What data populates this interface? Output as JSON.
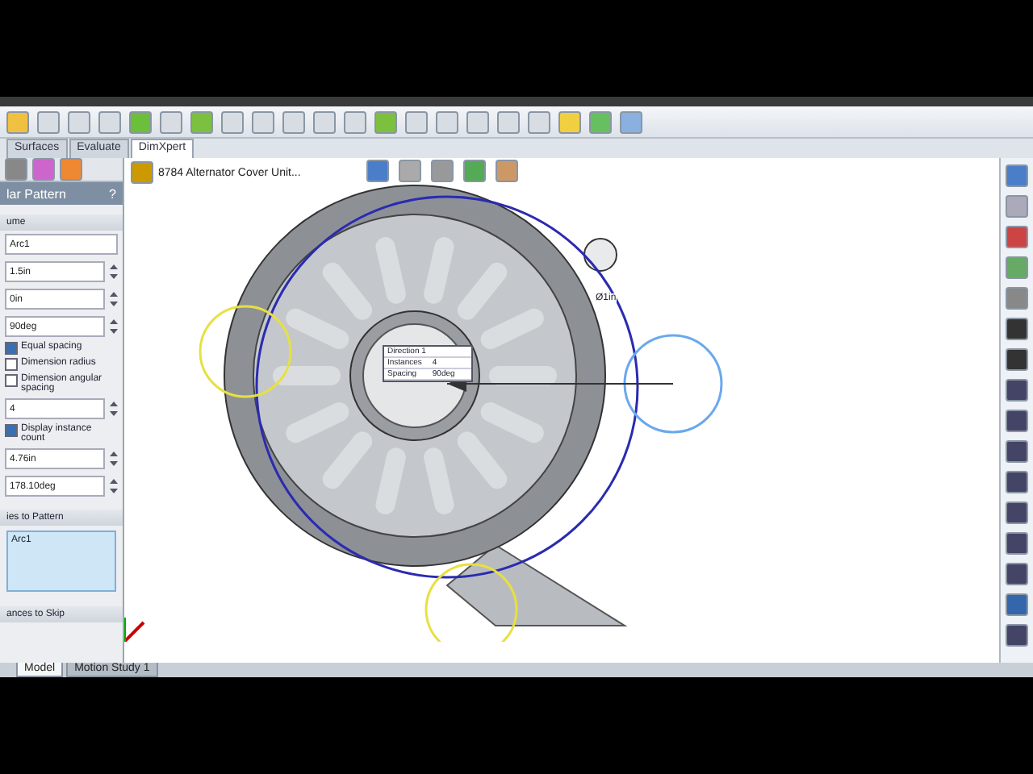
{
  "command_tabs": [
    {
      "label": "Surfaces",
      "selected": false
    },
    {
      "label": "Evaluate",
      "selected": false
    },
    {
      "label": "DimXpert",
      "selected": true
    }
  ],
  "feature_tree": {
    "label": "8784 Alternator Cover Unit..."
  },
  "property_manager": {
    "title": "lar Pattern",
    "help": "?",
    "parameters": {
      "title": "ume",
      "fields": [
        {
          "value": "Arc1"
        },
        {
          "value": "1.5in"
        },
        {
          "value": "0in"
        },
        {
          "value": "90deg"
        }
      ],
      "options": [
        {
          "label": "Equal spacing",
          "checked": true
        },
        {
          "label": "Dimension radius",
          "checked": false
        },
        {
          "label": "Dimension angular spacing",
          "checked": false
        }
      ],
      "count": {
        "value": "4"
      },
      "display_count": {
        "label": "Display instance count",
        "checked": true
      },
      "extra_fields": [
        {
          "value": "4.76in"
        },
        {
          "value": "178.10deg"
        }
      ]
    },
    "entities": {
      "title": "ies to Pattern",
      "items": [
        "Arc1"
      ]
    },
    "skip": {
      "title": "ances to Skip"
    }
  },
  "callout": {
    "rows": [
      {
        "label": "Direction 1",
        "value": ""
      },
      {
        "label": "Instances",
        "value": "4"
      },
      {
        "label": "Spacing",
        "value": "90deg"
      }
    ]
  },
  "dimension": {
    "text": "Ø1in"
  },
  "bottom_tabs": [
    {
      "label": "Model",
      "selected": true
    },
    {
      "label": "Motion Study 1",
      "selected": false
    }
  ]
}
